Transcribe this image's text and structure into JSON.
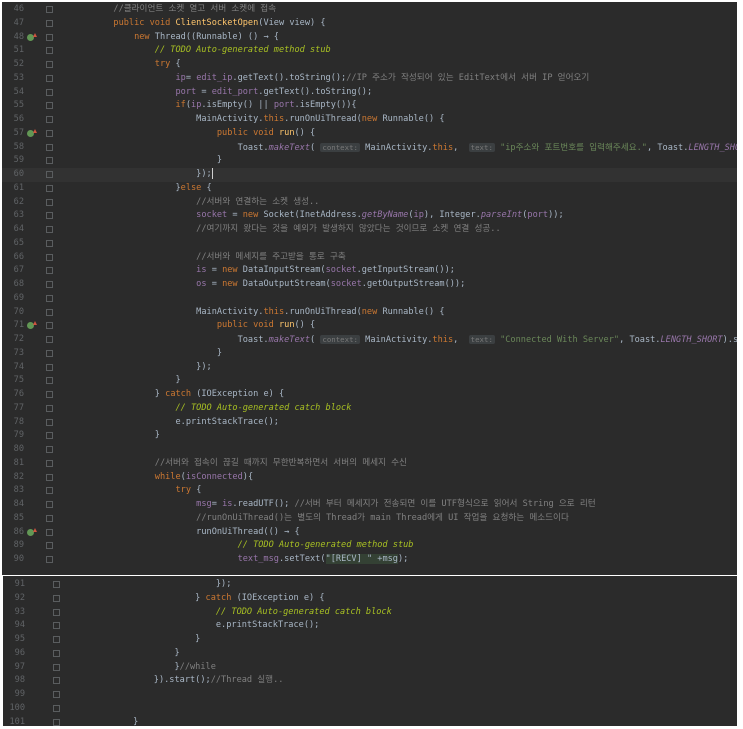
{
  "editor": {
    "lines": [
      {
        "n": "46",
        "parts": [
          [
            "cm",
            "        //클라이언트 소켓 열고 서버 소켓에 접속"
          ]
        ]
      },
      {
        "n": "47",
        "parts": [
          [
            "kw",
            "        public void "
          ],
          [
            "fn",
            "ClientSocketOpen"
          ],
          [
            "",
            "(View view) {"
          ]
        ]
      },
      {
        "n": "48",
        "ov": true,
        "parts": [
          [
            "kw",
            "            new "
          ],
          [
            "",
            "Thread((Runnable) () → {"
          ]
        ]
      },
      {
        "n": "51",
        "parts": [
          [
            "td",
            "                // TODO Auto-generated method stub"
          ]
        ]
      },
      {
        "n": "52",
        "parts": [
          [
            "kw",
            "                try "
          ],
          [
            "",
            "{"
          ]
        ]
      },
      {
        "n": "53",
        "parts": [
          [
            "fd",
            "                    ip"
          ],
          [
            "",
            "= "
          ],
          [
            "fd",
            "edit_ip"
          ],
          [
            "",
            ".getText().toString();"
          ],
          [
            "cm",
            "//IP 주소가 작성되어 있는 EditText에서 서버 IP 얻어오기"
          ]
        ]
      },
      {
        "n": "54",
        "parts": [
          [
            "fd",
            "                    port"
          ],
          [
            "",
            " = "
          ],
          [
            "fd",
            "edit_port"
          ],
          [
            "",
            ".getText().toString();"
          ]
        ]
      },
      {
        "n": "55",
        "parts": [
          [
            "kw",
            "                    if"
          ],
          [
            "",
            "("
          ],
          [
            "fd",
            "ip"
          ],
          [
            "",
            ".isEmpty() || "
          ],
          [
            "fd",
            "port"
          ],
          [
            "",
            ".isEmpty()){"
          ]
        ]
      },
      {
        "n": "56",
        "parts": [
          [
            "",
            "                        MainActivity."
          ],
          [
            "kw",
            "this"
          ],
          [
            "",
            ".runOnUiThread("
          ],
          [
            "kw",
            "new "
          ],
          [
            "",
            "Runnable() {"
          ]
        ]
      },
      {
        "n": "57",
        "ov": true,
        "parts": [
          [
            "kw",
            "                            public void "
          ],
          [
            "fn",
            "run"
          ],
          [
            "",
            "() {"
          ]
        ]
      },
      {
        "n": "58",
        "parts": [
          [
            "",
            "                                Toast."
          ],
          [
            "it",
            "makeText"
          ],
          [
            "",
            "( "
          ],
          [
            "hint",
            "context:"
          ],
          [
            "",
            " MainActivity."
          ],
          [
            "kw",
            "this"
          ],
          [
            "",
            ",  "
          ],
          [
            "hint",
            "text:"
          ],
          [
            "st",
            " \"ip주소와 포트번호를 입력해주세요.\""
          ],
          [
            "",
            ", Toast."
          ],
          [
            "it",
            "LENGTH_SHORT"
          ],
          [
            "",
            ").show();"
          ]
        ]
      },
      {
        "n": "59",
        "parts": [
          [
            "",
            "                            }"
          ]
        ]
      },
      {
        "n": "60",
        "hl": true,
        "parts": [
          [
            "",
            "                        });"
          ],
          [
            "caret",
            ""
          ]
        ]
      },
      {
        "n": "61",
        "parts": [
          [
            "",
            "                    }"
          ],
          [
            "kw",
            "else "
          ],
          [
            "",
            "{"
          ]
        ]
      },
      {
        "n": "62",
        "parts": [
          [
            "cm",
            "                        //서버와 연결하는 소켓 생성.."
          ]
        ]
      },
      {
        "n": "63",
        "parts": [
          [
            "fd",
            "                        socket"
          ],
          [
            "",
            " = "
          ],
          [
            "kw",
            "new "
          ],
          [
            "",
            "Socket(InetAddress."
          ],
          [
            "it",
            "getByName"
          ],
          [
            "",
            "("
          ],
          [
            "fd",
            "ip"
          ],
          [
            "",
            "), Integer."
          ],
          [
            "it",
            "parseInt"
          ],
          [
            "",
            "("
          ],
          [
            "fd",
            "port"
          ],
          [
            "",
            "));"
          ]
        ]
      },
      {
        "n": "64",
        "parts": [
          [
            "cm",
            "                        //여기까지 왔다는 것을 예외가 발생하지 않았다는 것이므로 소켓 연결 성공.."
          ]
        ]
      },
      {
        "n": "65",
        "parts": [
          [
            "",
            ""
          ]
        ]
      },
      {
        "n": "66",
        "parts": [
          [
            "cm",
            "                        //서버와 메세지를 주고받을 통로 구축"
          ]
        ]
      },
      {
        "n": "67",
        "parts": [
          [
            "fd",
            "                        is"
          ],
          [
            "",
            " = "
          ],
          [
            "kw",
            "new "
          ],
          [
            "",
            "DataInputStream("
          ],
          [
            "fd",
            "socket"
          ],
          [
            "",
            ".getInputStream());"
          ]
        ]
      },
      {
        "n": "68",
        "parts": [
          [
            "fd",
            "                        os"
          ],
          [
            "",
            " = "
          ],
          [
            "kw",
            "new "
          ],
          [
            "",
            "DataOutputStream("
          ],
          [
            "fd",
            "socket"
          ],
          [
            "",
            ".getOutputStream());"
          ]
        ]
      },
      {
        "n": "69",
        "parts": [
          [
            "",
            ""
          ]
        ]
      },
      {
        "n": "70",
        "parts": [
          [
            "",
            "                        MainActivity."
          ],
          [
            "kw",
            "this"
          ],
          [
            "",
            ".runOnUiThread("
          ],
          [
            "kw",
            "new "
          ],
          [
            "",
            "Runnable() {"
          ]
        ]
      },
      {
        "n": "71",
        "ov": true,
        "parts": [
          [
            "kw",
            "                            public void "
          ],
          [
            "fn",
            "run"
          ],
          [
            "",
            "() {"
          ]
        ]
      },
      {
        "n": "72",
        "parts": [
          [
            "",
            "                                Toast."
          ],
          [
            "it",
            "makeText"
          ],
          [
            "",
            "( "
          ],
          [
            "hint",
            "context:"
          ],
          [
            "",
            " MainActivity."
          ],
          [
            "kw",
            "this"
          ],
          [
            "",
            ",  "
          ],
          [
            "hint",
            "text:"
          ],
          [
            "st",
            " \"Connected With Server\""
          ],
          [
            "",
            ", Toast."
          ],
          [
            "it",
            "LENGTH_SHORT"
          ],
          [
            "",
            ").show();"
          ]
        ]
      },
      {
        "n": "73",
        "parts": [
          [
            "",
            "                            }"
          ]
        ]
      },
      {
        "n": "74",
        "parts": [
          [
            "",
            "                        });"
          ]
        ]
      },
      {
        "n": "75",
        "parts": [
          [
            "",
            "                    }"
          ]
        ]
      },
      {
        "n": "76",
        "parts": [
          [
            "",
            "                } "
          ],
          [
            "kw",
            "catch "
          ],
          [
            "",
            "(IOException e) {"
          ]
        ]
      },
      {
        "n": "77",
        "parts": [
          [
            "td",
            "                    // TODO Auto-generated catch block"
          ]
        ]
      },
      {
        "n": "78",
        "parts": [
          [
            "",
            "                    e.printStackTrace();"
          ]
        ]
      },
      {
        "n": "79",
        "parts": [
          [
            "",
            "                }"
          ]
        ]
      },
      {
        "n": "80",
        "parts": [
          [
            "",
            ""
          ]
        ]
      },
      {
        "n": "81",
        "parts": [
          [
            "cm",
            "                //서버와 접속이 끊길 때까지 무한반복하면서 서버의 메세지 수신"
          ]
        ]
      },
      {
        "n": "82",
        "parts": [
          [
            "kw",
            "                while"
          ],
          [
            "",
            "("
          ],
          [
            "fd",
            "isConnected"
          ],
          [
            "",
            "){"
          ]
        ]
      },
      {
        "n": "83",
        "parts": [
          [
            "kw",
            "                    try "
          ],
          [
            "",
            "{"
          ]
        ]
      },
      {
        "n": "84",
        "parts": [
          [
            "fd",
            "                        msg"
          ],
          [
            "",
            "= "
          ],
          [
            "fd",
            "is"
          ],
          [
            "",
            ".readUTF(); "
          ],
          [
            "cm",
            "//서버 부터 메세지가 전송되면 이를 UTF형식으로 읽어서 String 으로 리턴"
          ]
        ]
      },
      {
        "n": "85",
        "parts": [
          [
            "cm",
            "                        //runOnUiThread()는 별도의 Thread가 main Thread에게 UI 작업을 요청하는 메소드이다"
          ]
        ]
      },
      {
        "n": "86",
        "ov": true,
        "parts": [
          [
            "",
            "                        runOnUiThread(() → {"
          ]
        ]
      },
      {
        "n": "89",
        "parts": [
          [
            "td",
            "                                // TODO Auto-generated method stub"
          ]
        ]
      },
      {
        "n": "90",
        "parts": [
          [
            "fd",
            "                                text_msg"
          ],
          [
            "",
            ".setText("
          ],
          [
            "hilite",
            "\"[RECV] \" +msg"
          ],
          [
            "",
            ");"
          ]
        ]
      }
    ],
    "lines2": [
      {
        "n": "91",
        "parts": [
          [
            "",
            "                            });"
          ]
        ]
      },
      {
        "n": "92",
        "parts": [
          [
            "",
            "                        } "
          ],
          [
            "kw",
            "catch "
          ],
          [
            "",
            "(IOException e) {"
          ]
        ]
      },
      {
        "n": "93",
        "parts": [
          [
            "td",
            "                            // TODO Auto-generated catch block"
          ]
        ]
      },
      {
        "n": "94",
        "parts": [
          [
            "",
            "                            e.printStackTrace();"
          ]
        ]
      },
      {
        "n": "95",
        "parts": [
          [
            "",
            "                        }"
          ]
        ]
      },
      {
        "n": "96",
        "parts": [
          [
            "",
            "                    }"
          ]
        ]
      },
      {
        "n": "97",
        "parts": [
          [
            "",
            "                    }"
          ],
          [
            "cm",
            "//while"
          ]
        ]
      },
      {
        "n": "98",
        "parts": [
          [
            "",
            "                }).start();"
          ],
          [
            "cm",
            "//Thread 실행.."
          ]
        ]
      },
      {
        "n": "99",
        "parts": [
          [
            "",
            ""
          ]
        ]
      },
      {
        "n": "100",
        "parts": [
          [
            "",
            ""
          ]
        ]
      },
      {
        "n": "101",
        "parts": [
          [
            "",
            "            }"
          ]
        ]
      },
      {
        "n": "102",
        "parts": [
          [
            "",
            ""
          ]
        ]
      }
    ]
  }
}
